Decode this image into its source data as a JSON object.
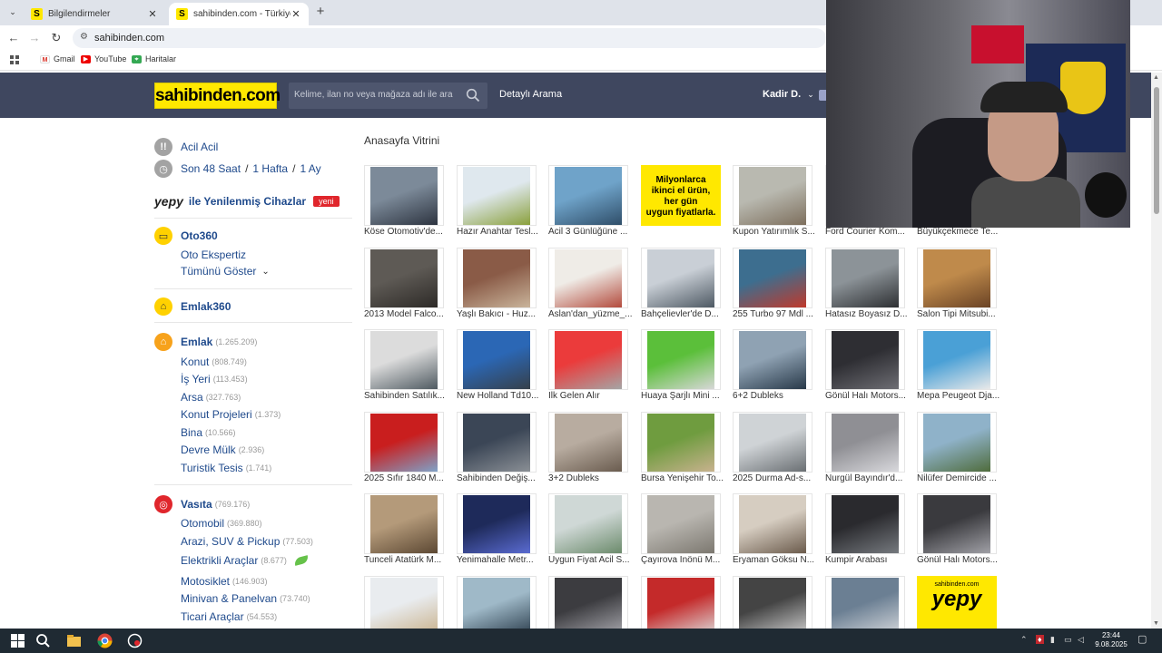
{
  "browser": {
    "tabs": [
      {
        "label": "Bilgilendirmeler",
        "favicon": "S"
      },
      {
        "label": "sahibinden.com - Türkiye'nin Online",
        "favicon": "S"
      }
    ],
    "url": "sahibinden.com",
    "bookmarks": [
      "Gmail",
      "YouTube",
      "Haritalar"
    ]
  },
  "header": {
    "logo": "sahibinden.com",
    "search_placeholder": "Kelime, ilan no veya mağaza adı ile ara",
    "advanced_search": "Detaylı Arama",
    "user_name": "Kadir D.",
    "brand_color": "#ffe800",
    "header_bg": "#3f475f"
  },
  "sidebar": {
    "urgent": "Acil Acil",
    "recent": [
      "Son 48 Saat",
      "1 Hafta",
      "1 Ay"
    ],
    "recent_sep": "/",
    "yepy_brand": "yepy",
    "yepy_label": "ile Yenilenmiş Cihazlar",
    "yepy_badge": "yeni",
    "oto360": {
      "title": "Oto360",
      "items": [
        "Oto Ekspertiz",
        "Tümünü Göster"
      ]
    },
    "emlak360": {
      "title": "Emlak360"
    },
    "emlak": {
      "title": "Emlak",
      "count": "(1.265.209)",
      "items": [
        {
          "label": "Konut",
          "count": "(808.749)"
        },
        {
          "label": "İş Yeri",
          "count": "(113.453)"
        },
        {
          "label": "Arsa",
          "count": "(327.763)"
        },
        {
          "label": "Konut Projeleri",
          "count": "(1.373)"
        },
        {
          "label": "Bina",
          "count": "(10.566)"
        },
        {
          "label": "Devre Mülk",
          "count": "(2.936)"
        },
        {
          "label": "Turistik Tesis",
          "count": "(1.741)"
        }
      ]
    },
    "vasita": {
      "title": "Vasıta",
      "count": "(769.176)",
      "items": [
        {
          "label": "Otomobil",
          "count": "(369.880)"
        },
        {
          "label": "Arazi, SUV & Pickup",
          "count": "(77.503)"
        },
        {
          "label": "Elektrikli Araçlar",
          "count": "(8.677)"
        },
        {
          "label": "Motosiklet",
          "count": "(146.903)"
        },
        {
          "label": "Minivan & Panelvan",
          "count": "(73.740)"
        },
        {
          "label": "Ticari Araçlar",
          "count": "(54.553)"
        }
      ]
    }
  },
  "showcase": {
    "title": "Anasayfa Vitrini",
    "promo_lines": [
      "Milyonlarca",
      "ikinci el ürün,",
      "her gün",
      "uygun fiyatlarla."
    ],
    "promo2_small": "sahibinden.com",
    "promo2_big": "yepy",
    "items": [
      "Köse Otomotiv'de...",
      "Hazır Anahtar Tesl...",
      "Acil 3 Günlüğüne ...",
      "",
      "Kupon Yatırımlık S...",
      "Ford Courier Kom...",
      "Büyükçekmece Te...",
      "2013 Model Falco...",
      "Yaşlı Bakıcı - Huz...",
      "Aslan'dan_yüzme_...",
      "Bahçelievler'de D...",
      "255 Turbo 97 Mdl ...",
      "Hatasız Boyasız D...",
      "Salon Tipi Mitsubi...",
      "Sahibinden Satılık...",
      "New Holland Td10...",
      "İlk Gelen Alır",
      "Huaya Şarjlı Mini ...",
      "6+2 Dubleks",
      "Gönül Halı Motors...",
      "Mepa Peugeot Dja...",
      "2025 Sıfır 1840 M...",
      "Sahibinden Değiş...",
      "3+2 Dubleks",
      "Bursa Yenişehir To...",
      "2025 Durma Ad-s...",
      "Nurgül Bayındır'd...",
      "Nilüfer Demircide ...",
      "Tunceli Atatürk M...",
      "Yenimahalle Metr...",
      "Uygun Fiyat Acil S...",
      "Çayırova İnönü M...",
      "Eryaman Göksu N...",
      "Kumpir Arabası",
      "Gönül Halı Motors...",
      "",
      "",
      "",
      "",
      "",
      "",
      ""
    ]
  },
  "taskbar": {
    "time": "23:44",
    "date": "9.08.2025"
  }
}
